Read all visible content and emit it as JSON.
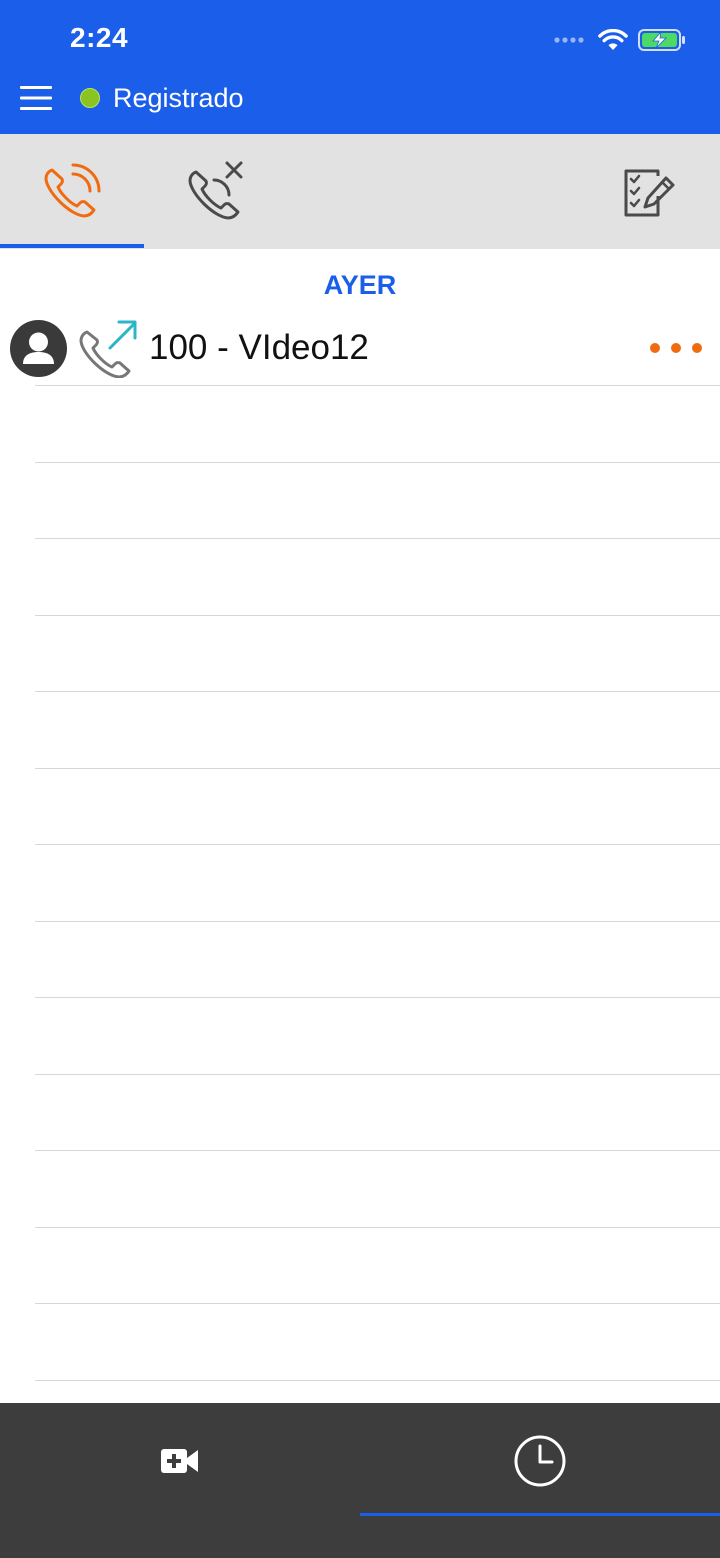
{
  "status_bar": {
    "time": "2:24",
    "battery_level": 1.0,
    "battery_charging": true
  },
  "header": {
    "registration_label": "Registrado",
    "registration_color": "#8ac420",
    "background_color": "#1a5eea",
    "menu_icon": "hamburger-menu-icon"
  },
  "tabs": [
    {
      "name": "all-calls",
      "icon": "phone-calls-icon",
      "active": true
    },
    {
      "name": "missed-calls",
      "icon": "missed-call-icon",
      "active": false
    },
    {
      "name": "edit",
      "icon": "checklist-edit-icon",
      "active": false
    }
  ],
  "call_log": {
    "section_label": "AYER",
    "entries": [
      {
        "title": "100 - VIdeo12",
        "direction": "outgoing",
        "direction_icon": "outgoing-call-icon",
        "avatar_icon": "person-avatar-icon",
        "more_icon": "more-dots-icon"
      }
    ]
  },
  "bottom_nav": {
    "items": [
      {
        "name": "video-call",
        "icon": "video-add-icon",
        "active": false
      },
      {
        "name": "history",
        "icon": "clock-icon",
        "active": true
      }
    ]
  },
  "colors": {
    "accent_orange": "#f06a10",
    "accent_blue": "#1a5eea",
    "outgoing_arrow": "#2bb5c8",
    "bottom_bar": "#3d3d3d",
    "tab_bar": "#e2e2e2"
  }
}
